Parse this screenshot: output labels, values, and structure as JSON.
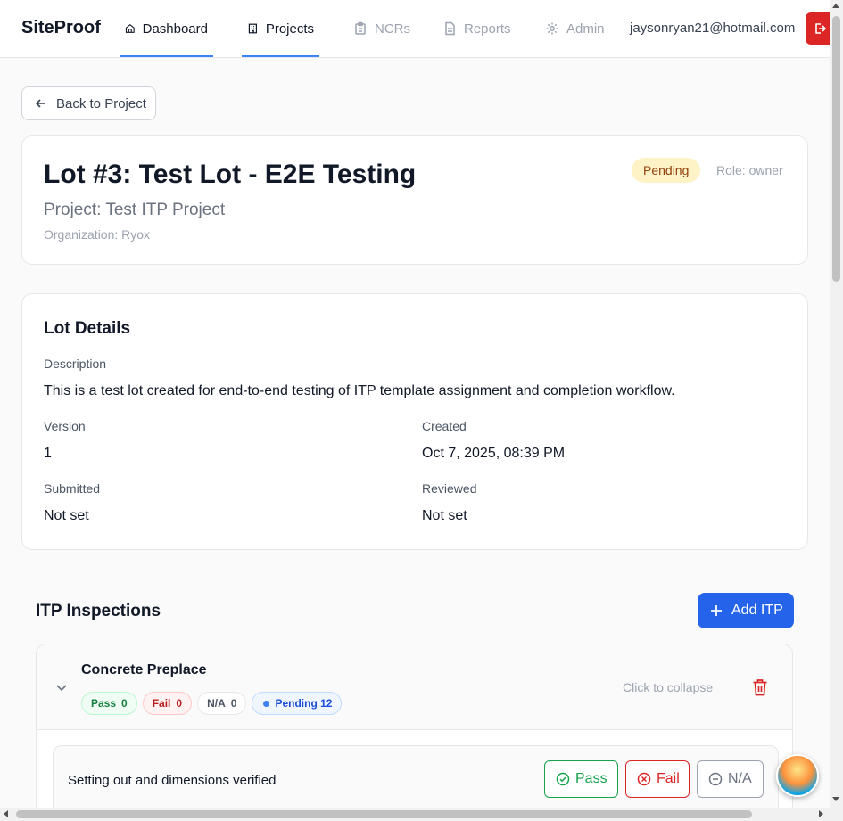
{
  "nav": {
    "brand": "SiteProof",
    "items": [
      {
        "label": "Dashboard",
        "icon": "home-icon"
      },
      {
        "label": "Projects",
        "icon": "building-icon"
      },
      {
        "label": "NCRs",
        "icon": "clipboard-icon"
      },
      {
        "label": "Reports",
        "icon": "file-text-icon"
      },
      {
        "label": "Admin",
        "icon": "gear-icon"
      }
    ],
    "user_email": "jaysonryan21@hotmail.com"
  },
  "back_button": "Back to Project",
  "lot": {
    "title": "Lot #3: Test Lot - E2E Testing",
    "project": "Project: Test ITP Project",
    "organization": "Organization: Ryox",
    "status": "Pending",
    "role": "Role: owner"
  },
  "details": {
    "title": "Lot Details",
    "description_label": "Description",
    "description": "This is a test lot created for end-to-end testing of ITP template assignment and completion workflow.",
    "version_label": "Version",
    "version": "1",
    "created_label": "Created",
    "created": "Oct 7, 2025, 08:39 PM",
    "submitted_label": "Submitted",
    "submitted": "Not set",
    "reviewed_label": "Reviewed",
    "reviewed": "Not set"
  },
  "itp": {
    "title": "ITP Inspections",
    "add_button": "Add ITP",
    "template": {
      "name": "Concrete Preplace",
      "pass_label": "Pass",
      "pass_count": "0",
      "fail_label": "Fail",
      "fail_count": "0",
      "na_label": "N/A",
      "na_count": "0",
      "pending_label": "Pending 12",
      "collapse_hint": "Click to collapse",
      "items": [
        {
          "text": "Setting out and dimensions verified",
          "pass": "Pass",
          "fail": "Fail",
          "na": "N/A"
        }
      ]
    }
  },
  "colors": {
    "primary": "#2563eb",
    "danger": "#dc2626",
    "success": "#16a34a",
    "pending_bg": "#fef3c7"
  }
}
